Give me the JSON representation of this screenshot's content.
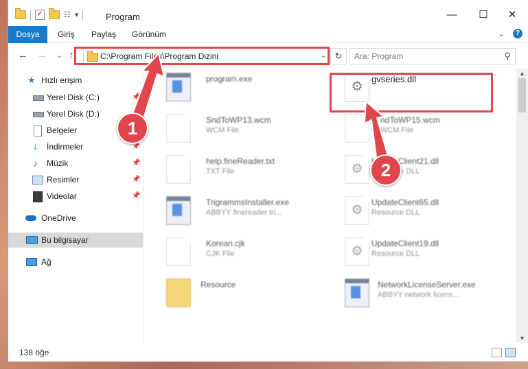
{
  "window": {
    "title": "Program"
  },
  "ribbon": {
    "tabs": [
      "Dosya",
      "Giriş",
      "Paylaş",
      "Görünüm"
    ],
    "expand_glyph": "⌄",
    "help_glyph": "?"
  },
  "titlebar": {
    "min_glyph": "—",
    "max_glyph": "☐",
    "close_glyph": "✕",
    "qat_arrow": "▾"
  },
  "nav": {
    "back_glyph": "←",
    "forward_glyph": "→",
    "recent_glyph": "⌄",
    "up_glyph": "↑",
    "address": "C:\\Program Files\\Program Dizini",
    "dropdown_glyph": "⌄",
    "refresh_glyph": "↻",
    "search_placeholder": "Ara: Program",
    "search_glyph": "⚲"
  },
  "sidebar": {
    "items": [
      {
        "label": "Hızlı erişim",
        "icon": "star-icon"
      },
      {
        "label": "Yerel Disk (C:)",
        "icon": "drive-icon",
        "pin": "📌"
      },
      {
        "label": "Yerel Disk (D:)",
        "icon": "drive-icon",
        "pin": "📌"
      },
      {
        "label": "Belgeler",
        "icon": "document-icon",
        "pin": "📌"
      },
      {
        "label": "İndirmeler",
        "icon": "download-icon",
        "pin": "📌"
      },
      {
        "label": "Müzik",
        "icon": "music-icon",
        "pin": "📌"
      },
      {
        "label": "Resimler",
        "icon": "pictures-icon",
        "pin": "📌"
      },
      {
        "label": "Videolar",
        "icon": "video-icon",
        "pin": "📌"
      },
      {
        "label": "OneDrive",
        "icon": "cloud-icon"
      },
      {
        "label": "Bu bilgisayar",
        "icon": "computer-icon"
      },
      {
        "label": "Ağ",
        "icon": "network-icon"
      }
    ]
  },
  "files": [
    {
      "name": "program.exe",
      "type": "",
      "icon": "program-icon"
    },
    {
      "name": "gvseries.dll",
      "type": "",
      "icon": "dll-gear-icon"
    },
    {
      "name": "SndToWP13.wcm",
      "type": "WCM File",
      "icon": "blank-file-icon"
    },
    {
      "name": "ndToWP15.wcm",
      "type": "WCM File",
      "icon": "blank-file-icon"
    },
    {
      "name": "help.fineReader.txt",
      "type": "TXT File",
      "icon": "text-file-icon"
    },
    {
      "name": "UpdateClient21.dll",
      "type": "Resource DLL",
      "icon": "dll-gear-icon"
    },
    {
      "name": "TrigrammsInstaller.exe",
      "type": "ABBYY finereader tri...",
      "icon": "exe-icon"
    },
    {
      "name": "UpdateClient65.dll",
      "type": "Resource DLL",
      "icon": "dll-gear-icon"
    },
    {
      "name": "Korean.cjk",
      "type": "CJK File",
      "icon": "blank-file-icon"
    },
    {
      "name": "UpdateClient19.dll",
      "type": "Resource DLL",
      "icon": "dll-gear-icon"
    },
    {
      "name": "Resource",
      "type": "",
      "icon": "folder-icon"
    },
    {
      "name": "NetworkLicenseServer.exe",
      "type": "ABBYY network licens...",
      "icon": "exe-icon"
    }
  ],
  "status": {
    "item_count": "138 öğe"
  },
  "annotations": {
    "badge1": "1",
    "badge2": "2"
  },
  "colors": {
    "accent": "#1979ca",
    "highlight": "#e0464c"
  }
}
